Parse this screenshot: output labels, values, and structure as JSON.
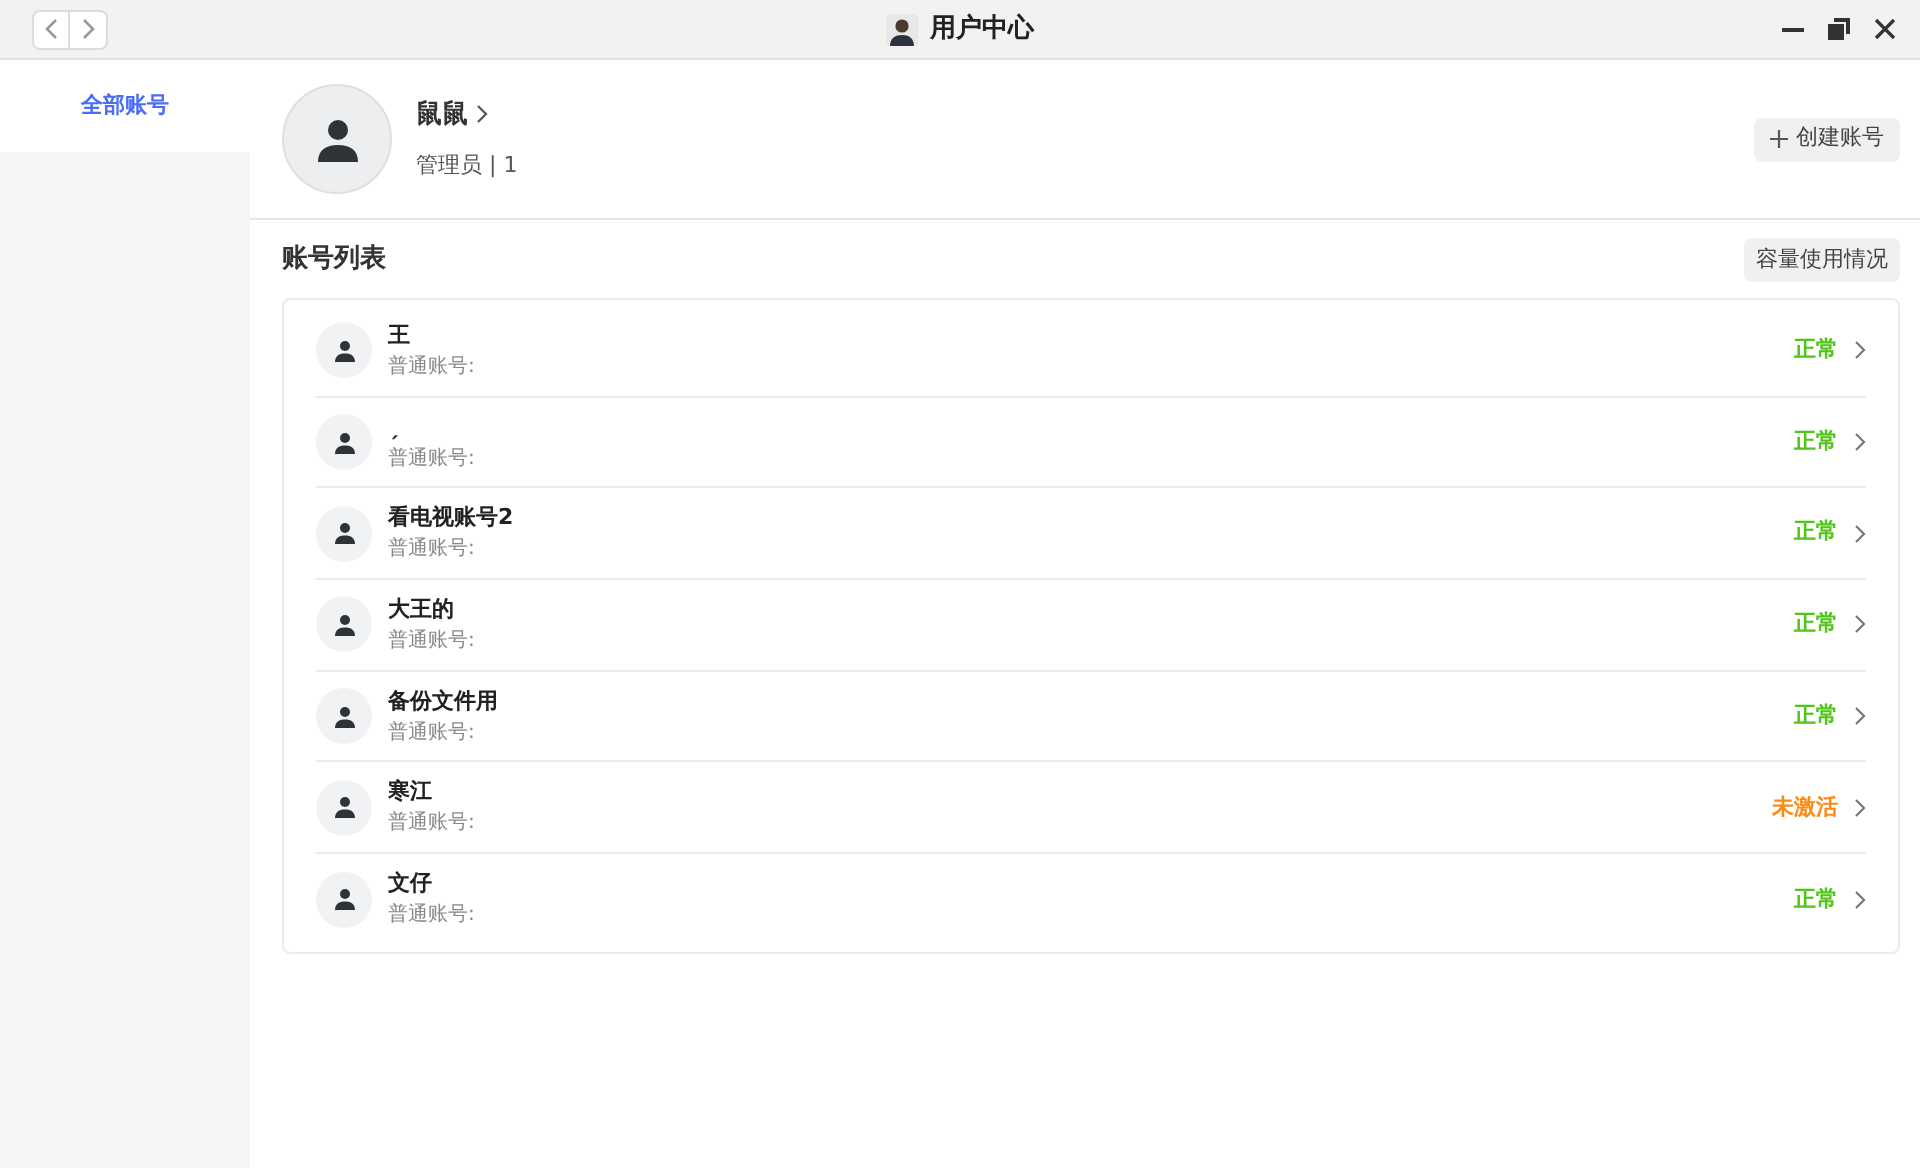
{
  "window": {
    "title": "用户中心"
  },
  "sidebar": {
    "items": [
      {
        "label": "全部账号",
        "selected": true
      }
    ]
  },
  "profile": {
    "name": "鼠鼠",
    "role": "管理员 | 1"
  },
  "create_button": "创建账号",
  "account_list": {
    "title": "账号列表",
    "usage_button": "容量使用情况",
    "rows": [
      {
        "name": "王",
        "type": "普通账号:",
        "status": "正常",
        "kind": "normal"
      },
      {
        "name": "ˏ",
        "type": "普通账号:",
        "status": "正常",
        "kind": "normal"
      },
      {
        "name": "看电视账号2",
        "type": "普通账号:",
        "status": "正常",
        "kind": "normal"
      },
      {
        "name": "大王的",
        "type": "普通账号:",
        "status": "正常",
        "kind": "normal"
      },
      {
        "name": "备份文件用",
        "type": "普通账号:",
        "status": "正常",
        "kind": "normal"
      },
      {
        "name": "寒江",
        "type": "普通账号:",
        "status": "未激活",
        "kind": "inactive"
      },
      {
        "name": "文仔",
        "type": "普通账号:",
        "status": "正常",
        "kind": "normal"
      }
    ]
  }
}
